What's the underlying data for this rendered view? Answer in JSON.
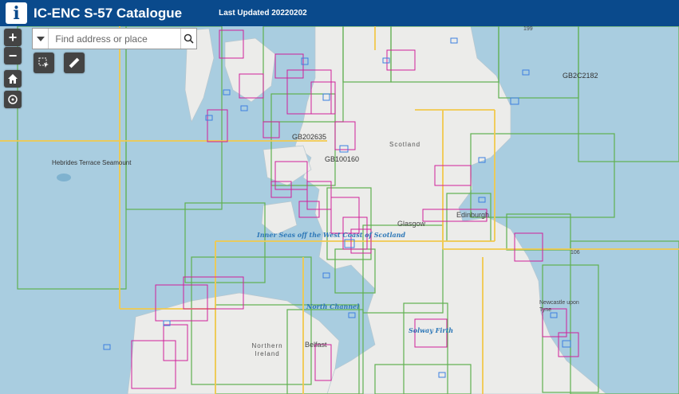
{
  "app": {
    "title": "IC-ENC S-57 Catalogue",
    "last_updated": "Last Updated 20220202"
  },
  "search": {
    "placeholder": "Find address or place",
    "value": ""
  },
  "controls": {
    "zoom_in": "+",
    "zoom_out": "−"
  },
  "map": {
    "place_labels": [
      "Scotland",
      "Glasgow",
      "Edinburgh",
      "Belfast",
      "Northern Ireland",
      "Newcastle upon Tyne"
    ],
    "sea_labels": [
      "Hebrides Terrace Seamount",
      "Inner Seas off the West Coast of Scotland",
      "North Channel",
      "Solway Firth"
    ],
    "chart_ids": [
      "GB202635",
      "GB100160",
      "GB2C2182"
    ],
    "edge_labels": [
      "199",
      "106"
    ],
    "colors": {
      "sea": "#a9cde0",
      "land": "#ececea",
      "coverage_green": "#5fb04f",
      "coverage_magenta": "#d0209a",
      "coverage_blue": "#3d7fe0",
      "grid_yellow": "#f2c94c"
    }
  }
}
